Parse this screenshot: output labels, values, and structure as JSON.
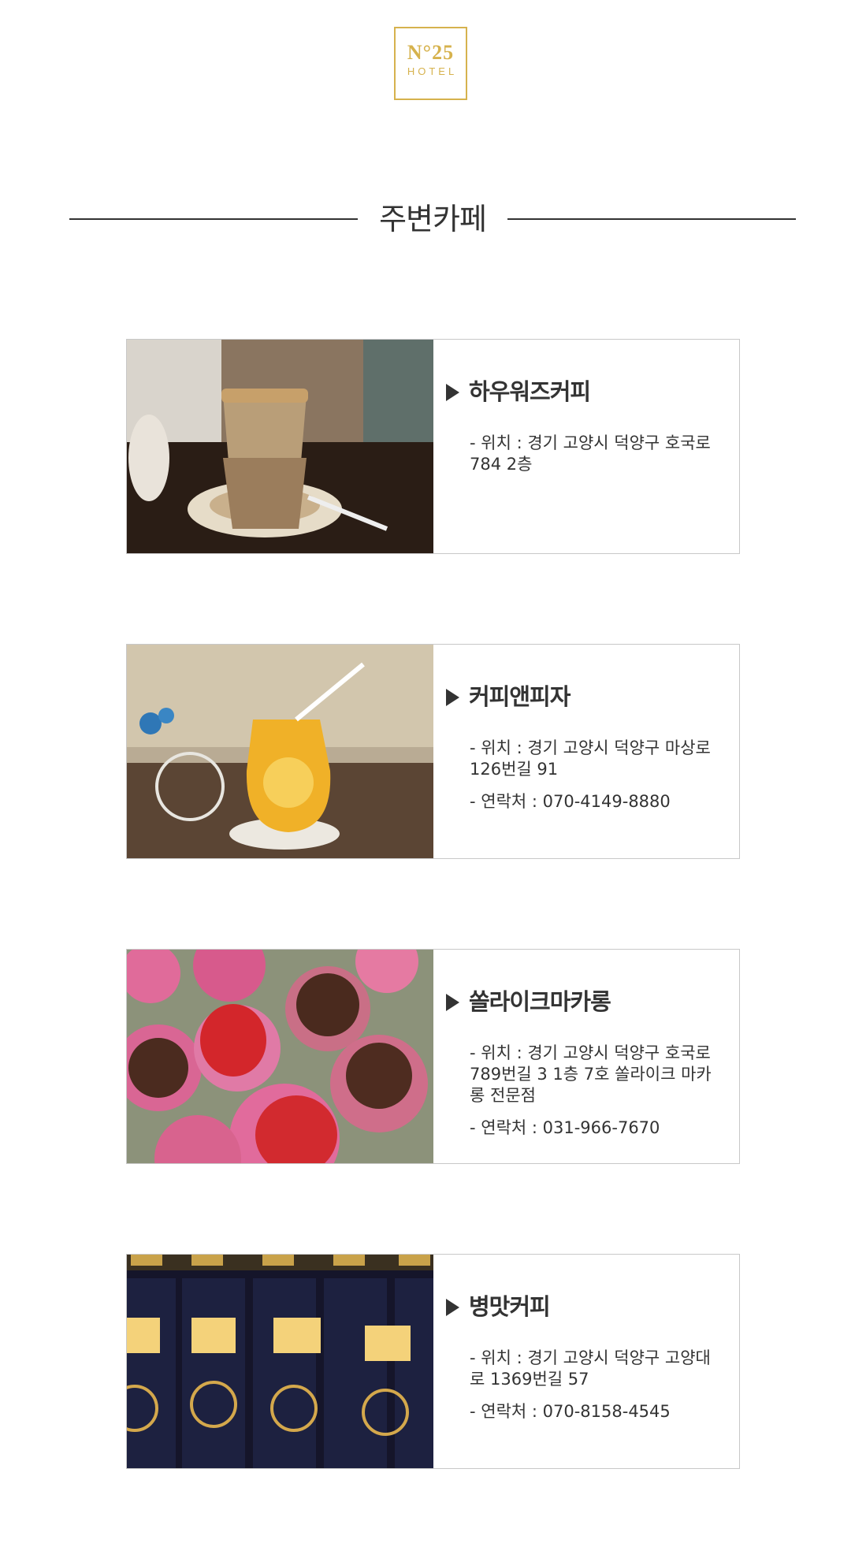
{
  "logo": {
    "line1": "N°25",
    "line2": "HOTEL"
  },
  "section_title": "주변카페",
  "cafes": [
    {
      "name": "하우워즈커피",
      "location": "- 위치 : 경기 고양시 덕양구 호국로 784 2층",
      "contact": ""
    },
    {
      "name": "커피앤피자",
      "location": "- 위치 : 경기 고양시 덕양구 마상로 126번길 91",
      "contact": "- 연락처 : 070-4149-8880"
    },
    {
      "name": "쏠라이크마카롱",
      "location": "- 위치 : 경기 고양시 덕양구 호국로 789번길 3 1층 7호 쏠라이크 마카롱 전문점",
      "contact": "- 연락처 : 031-966-7670"
    },
    {
      "name": "병맛커피",
      "location": "- 위치 : 경기 고양시 덕양구 고양대로 1369번길 57",
      "contact": "- 연락처 : 070-8158-4545"
    }
  ],
  "colors": {
    "brand_gold": "#d6b24d",
    "text": "#333333",
    "border": "#c8c8c8"
  }
}
